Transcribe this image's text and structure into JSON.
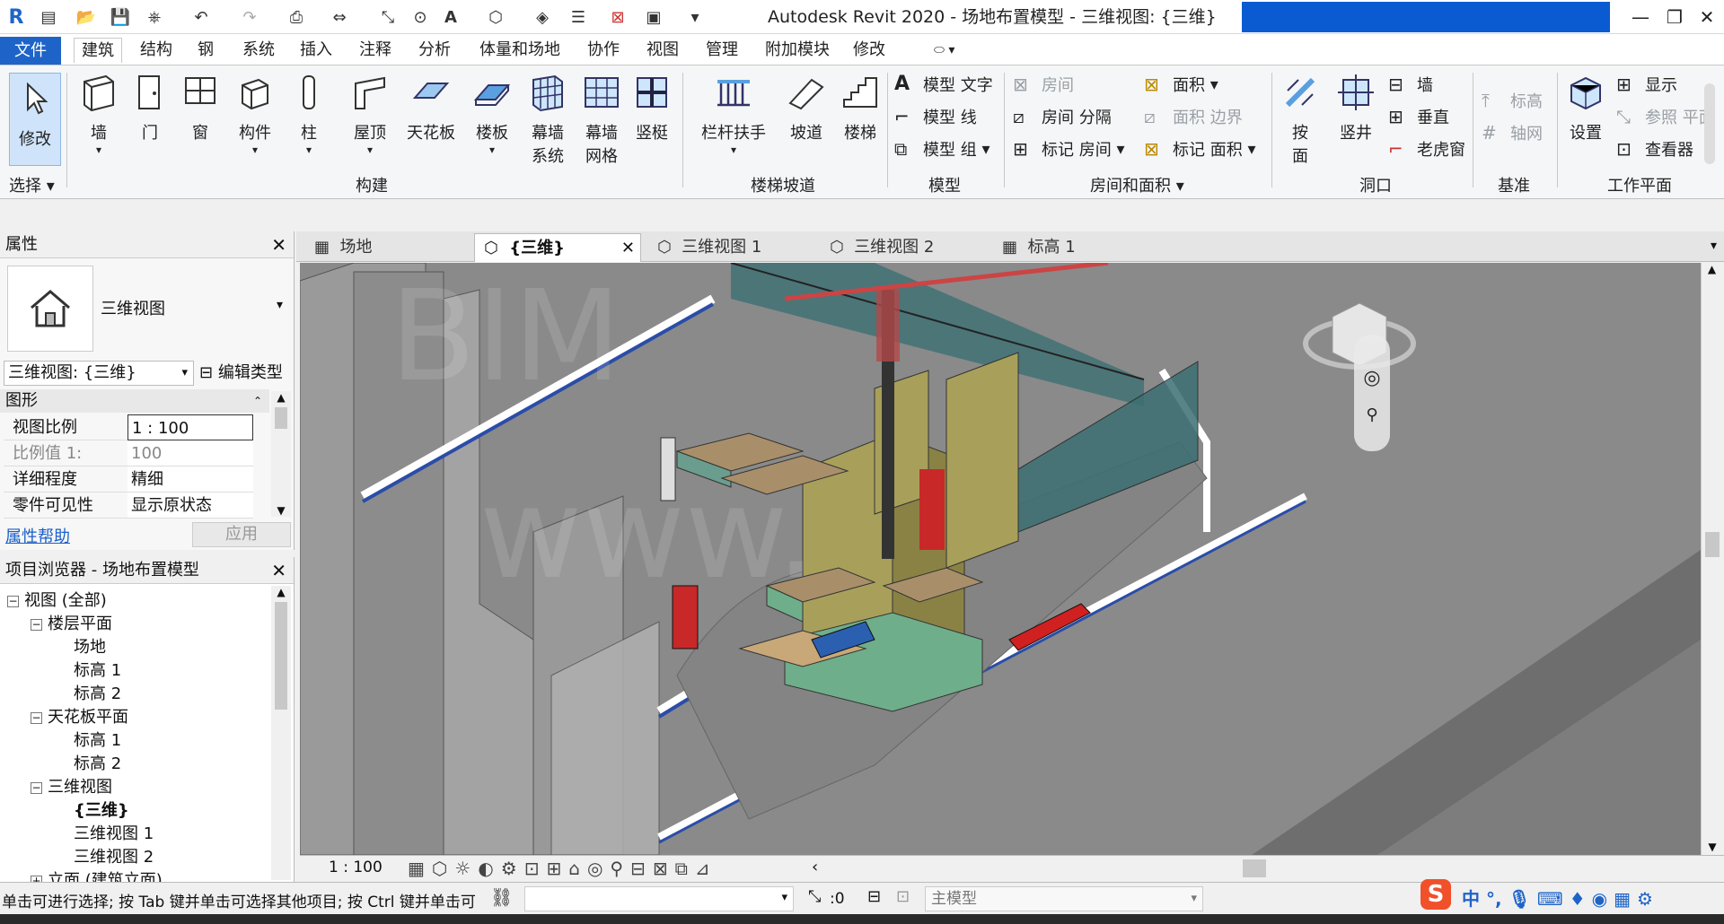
{
  "window": {
    "title": "Autodesk Revit 2020 - 场地布置模型 - 三维视图: {三维}",
    "accent": "#1e64c8"
  },
  "menu_tabs": [
    "文件",
    "建筑",
    "结构",
    "钢",
    "系统",
    "插入",
    "注释",
    "分析",
    "体量和场地",
    "协作",
    "视图",
    "管理",
    "附加模块",
    "修改"
  ],
  "active_tab": "建筑",
  "ribbon": {
    "select": {
      "modify": "修改",
      "label": "选择"
    },
    "build": {
      "wall": "墙",
      "door": "门",
      "window": "窗",
      "component": "构件",
      "column": "柱",
      "roof": "屋顶",
      "ceiling": "天花板",
      "floor": "楼板",
      "curtain_system": [
        "幕墙",
        "系统"
      ],
      "curtain_grid": [
        "幕墙",
        "网格"
      ],
      "mullion": "竖梃",
      "label": "构建"
    },
    "stairs": {
      "railing": "栏杆扶手",
      "ramp": "坡道",
      "stair": "楼梯",
      "label": "楼梯坡道"
    },
    "model": {
      "text": "模型 文字",
      "line": "模型 线",
      "group": "模型 组",
      "label": "模型"
    },
    "room": {
      "room": "房间",
      "room_sep": "房间 分隔",
      "tag_room": "标记 房间",
      "area": "面积",
      "area_boundary": "面积 边界",
      "tag_area": "标记 面积",
      "label": "房间和面积"
    },
    "opening": {
      "by_face": [
        "按",
        "面"
      ],
      "shaft": "竖井",
      "wall": "墙",
      "vertical": "垂直",
      "dormer": "老虎窗",
      "label": "洞口"
    },
    "datum": {
      "level": "标高",
      "grid": "轴网",
      "label": "基准"
    },
    "workplane": {
      "set": "设置",
      "show": "显示",
      "ref_plane": "参照 平面",
      "viewer": "查看器",
      "label": "工作平面"
    }
  },
  "properties": {
    "title": "属性",
    "type_name": "三维视图",
    "selector": "三维视图: {三维}",
    "edit_type": "编辑类型",
    "section": "图形",
    "rows": [
      {
        "k": "视图比例",
        "v": "1 : 100"
      },
      {
        "k": "比例值 1:",
        "v": "100"
      },
      {
        "k": "详细程度",
        "v": "精细"
      },
      {
        "k": "零件可见性",
        "v": "显示原状态"
      }
    ],
    "help": "属性帮助",
    "apply": "应用"
  },
  "browser": {
    "title": "项目浏览器 - 场地布置模型",
    "nodes": [
      {
        "t": "视图 (全部)",
        "lvl": 0,
        "tog": "−"
      },
      {
        "t": "楼层平面",
        "lvl": 1,
        "tog": "−"
      },
      {
        "t": "场地",
        "lvl": 2
      },
      {
        "t": "标高 1",
        "lvl": 2
      },
      {
        "t": "标高 2",
        "lvl": 2
      },
      {
        "t": "天花板平面",
        "lvl": 1,
        "tog": "−"
      },
      {
        "t": "标高 1",
        "lvl": 2
      },
      {
        "t": "标高 2",
        "lvl": 2
      },
      {
        "t": "三维视图",
        "lvl": 1,
        "tog": "−"
      },
      {
        "t": "{三维}",
        "lvl": 2,
        "bold": true
      },
      {
        "t": "三维视图 1",
        "lvl": 2
      },
      {
        "t": "三维视图 2",
        "lvl": 2
      },
      {
        "t": "立面 (建筑立面)",
        "lvl": 1,
        "tog": "+"
      }
    ]
  },
  "view_tabs": [
    {
      "label": "场地"
    },
    {
      "label": "{三维}",
      "active": true
    },
    {
      "label": "三维视图 1"
    },
    {
      "label": "三维视图 2"
    },
    {
      "label": "标高 1"
    }
  ],
  "view_control": {
    "scale": "1 : 100"
  },
  "status": {
    "message": "单击可进行选择; 按 Tab 键并单击可选择其他项目; 按 Ctrl 键并单击可",
    "filter_count": ":0",
    "main_model": "主模型"
  },
  "ime": {
    "lang": "中"
  }
}
